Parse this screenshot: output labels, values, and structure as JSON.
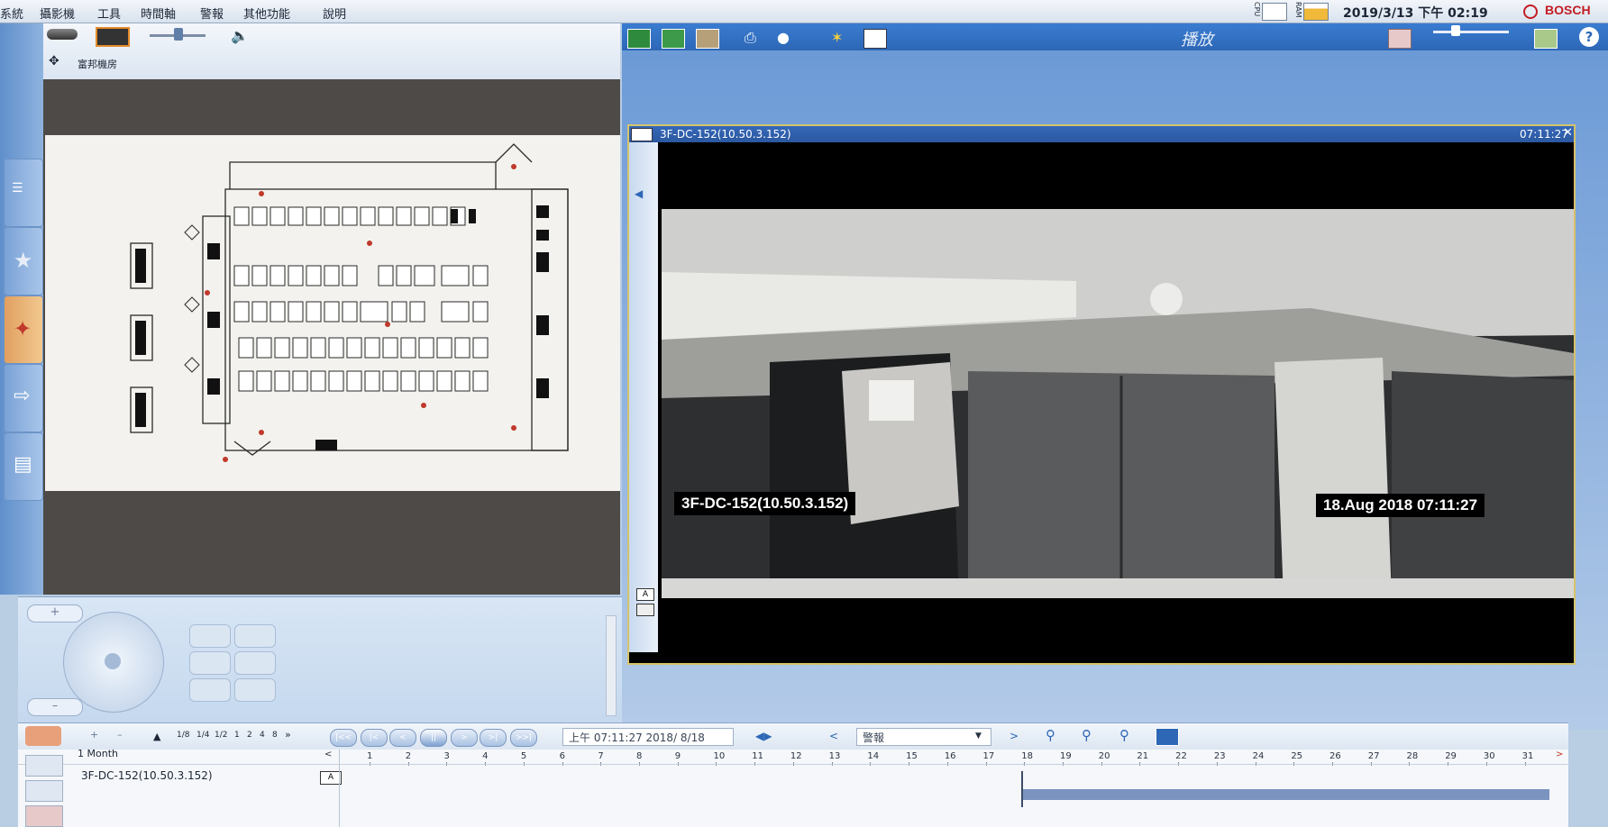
{
  "menu": {
    "items": [
      "系統",
      "攝影機",
      "工具",
      "時間軸",
      "警報",
      "其他功能",
      "說明"
    ]
  },
  "status": {
    "cpu_label": "CPU",
    "ram_label": "RAM",
    "datetime": "2019/3/13 下午 02:19",
    "brand": "BOSCH"
  },
  "map_panel": {
    "location_label": "富邦機房"
  },
  "playback": {
    "mode_label": "播放",
    "camera_title": "3F-DC-152(10.50.3.152)",
    "title_time": "07:11:27",
    "osd_camera": "3F-DC-152(10.50.3.152)",
    "osd_datetime": "18.Aug 2018   07:11:27"
  },
  "timeline": {
    "speeds": [
      "1/8",
      "1/4",
      "1/2",
      "1",
      "2",
      "4",
      "8"
    ],
    "current_time": "上午 07:11:27  2018/  8/18",
    "alarm_select": "警報",
    "range_label": "1 Month",
    "track_name": "3F-DC-152(10.50.3.152)",
    "track_badge": "A",
    "days": [
      "1",
      "2",
      "3",
      "4",
      "5",
      "6",
      "7",
      "8",
      "9",
      "10",
      "11",
      "12",
      "13",
      "14",
      "15",
      "16",
      "17",
      "18",
      "19",
      "20",
      "21",
      "22",
      "23",
      "24",
      "25",
      "26",
      "27",
      "28",
      "29",
      "30",
      "31"
    ],
    "recording_from_day": 18,
    "recording_to_day": 31.7
  },
  "colors": {
    "accent": "#2d67b6",
    "viewer_border": "#d6c36a",
    "recording_bar": "#7a93bf",
    "brand": "#c21d23"
  }
}
